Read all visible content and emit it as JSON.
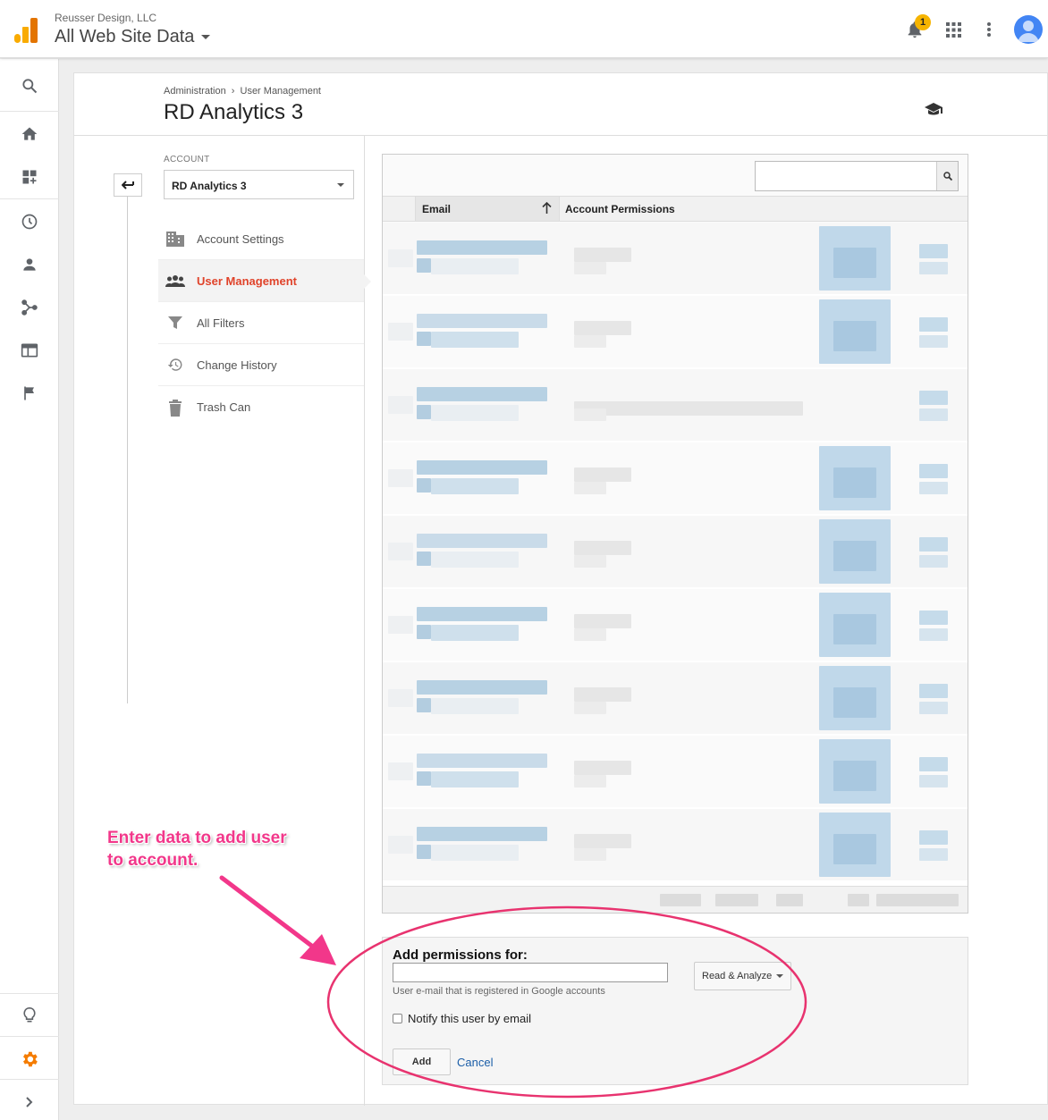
{
  "header": {
    "org_name": "Reusser Design, LLC",
    "property_name": "All Web Site Data",
    "notification_count": "1",
    "icons": [
      "analytics-logo-icon",
      "bell-icon",
      "apps-grid-icon",
      "more-vert-icon",
      "account-avatar-icon"
    ]
  },
  "leftnav": {
    "icons": [
      "search-icon",
      "home-icon",
      "dashboard-add-icon",
      "clock-icon",
      "person-icon",
      "acquisition-icon",
      "behavior-icon",
      "flag-icon",
      "lightbulb-icon",
      "settings-gear-icon",
      "chevron-right-icon"
    ],
    "accent_color": "#f57c00"
  },
  "page": {
    "breadcrumb_admin": "Administration",
    "breadcrumb_sep": "›",
    "breadcrumb_current": "User Management",
    "title": "RD Analytics 3"
  },
  "account": {
    "label": "ACCOUNT",
    "selected": "RD Analytics 3"
  },
  "menu": {
    "items": [
      {
        "label": "Account Settings",
        "icon": "building-icon",
        "active": false
      },
      {
        "label": "User Management",
        "icon": "people-icon",
        "active": true
      },
      {
        "label": "All Filters",
        "icon": "filter-icon",
        "active": false
      },
      {
        "label": "Change History",
        "icon": "history-icon",
        "active": false
      },
      {
        "label": "Trash Can",
        "icon": "trash-icon",
        "active": false
      }
    ],
    "active_color": "#e0432a"
  },
  "table": {
    "search_placeholder": "",
    "columns": [
      "Email",
      "Account Permissions"
    ],
    "sort_column": "Email",
    "sort_direction": "ascending"
  },
  "add_permissions": {
    "title": "Add permissions for:",
    "email_value": "",
    "hint": "User e-mail that is registered in Google accounts",
    "role_selected": "Read & Analyze",
    "notify_label": "Notify this user by email",
    "notify_checked": false,
    "add_label": "Add",
    "cancel_label": "Cancel"
  },
  "annotation": {
    "text_line1": "Enter data to add user",
    "text_line2": "to account.",
    "color": "#f2378a"
  }
}
